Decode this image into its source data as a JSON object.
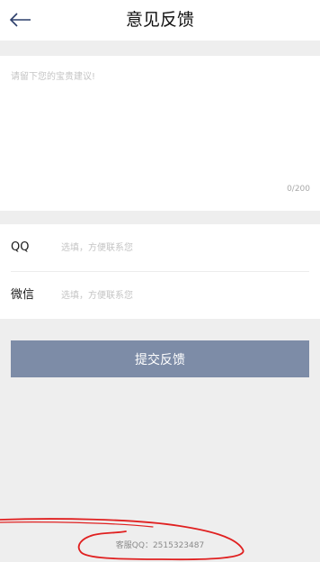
{
  "header": {
    "title": "意见反馈",
    "back_icon": "arrow-left-icon"
  },
  "feedback": {
    "placeholder": "请留下您的宝贵建议!",
    "value": "",
    "counter": "0/200"
  },
  "contact": {
    "qq": {
      "label": "QQ",
      "placeholder": "选填，方便联系您",
      "value": ""
    },
    "wechat": {
      "label": "微信",
      "placeholder": "选填，方便联系您",
      "value": ""
    }
  },
  "submit_label": "提交反馈",
  "service_text": "客服QQ：2515323487",
  "colors": {
    "button": "#7d8ca7",
    "back_arrow": "#2c3e6b",
    "scribble": "#e02020",
    "page_bg": "#eeeeee"
  }
}
